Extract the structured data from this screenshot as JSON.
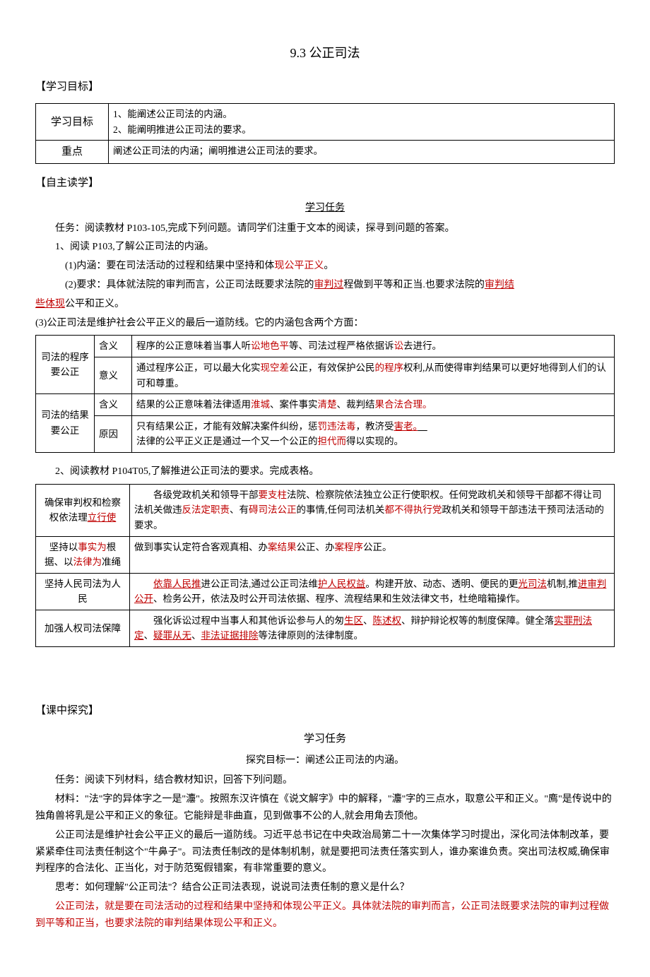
{
  "title": "9.3 公正司法",
  "sections": {
    "s1_heading": "【学习目标】",
    "s2_heading": "【自主读学】",
    "s3_heading": "【课中探究】"
  },
  "goal_table": {
    "r1c1": "学习目标",
    "r1c2_line1": "1、能阐述公正司法的内涵。",
    "r1c2_line2": "2、能阐明推进公正司法的要求。",
    "r2c1": "重点",
    "r2c2": "阐述公正司法的内涵；阐明推进公正司法的要求。"
  },
  "tasks": {
    "task_title": "学习任务",
    "task_intro": "任务：阅读教材 P103-105,完成下列问题。请同学们注重于文本的阅读，探寻到问题的答案。",
    "q1": "1、阅读 P103,了解公正司法的内涵。",
    "q1_1_pre": "(1)内涵：要在司法活动的过程和结果中坚持和体",
    "q1_1_red": "现公平正义",
    "q1_1_post": "。",
    "q1_2_pre": "(2)要求：具体就法院的审判而言，公正司法既要求法院的",
    "q1_2_red1": "审判过",
    "q1_2_mid": "程做到平等和正当.也要求法院的",
    "q1_2_red2": "审判结",
    "q1_2b_red": "些体现",
    "q1_2b_post": "公平和正义。",
    "q1_3": "(3)公正司法是维护社会公平正义的最后一道防线。它的内涵包含两个方面：",
    "q2": "2、阅读教材 P104T05,了解推进公正司法的要求。完成表格。"
  },
  "table1": {
    "r1c1": "司法的程序要公正",
    "r1c2a": "含义",
    "r1c3a_pre": "程序的公正意味着当事人听",
    "r1c3a_red1": "讼地色平",
    "r1c3a_mid": "等、司法过程严格依据诉",
    "r1c3a_red2": "讼",
    "r1c3a_post": "去进行。",
    "r1c2b": "意义",
    "r1c3b_pre": "通过程序公正，可以最大化实",
    "r1c3b_red1": "现空差",
    "r1c3b_mid": "公正，有效保护公民",
    "r1c3b_red2": "的程序",
    "r1c3b_post": "权利,从而使得审判结果可以更好地得到人们的认可和尊重。",
    "r2c1": "司法的结果要公正",
    "r2c2a": "含义",
    "r2c3a_pre": "结果的公正意味着法律适用",
    "r2c3a_red1": "淮城",
    "r2c3a_mid1": "、案件事实",
    "r2c3a_red2": "清楚",
    "r2c3a_mid2": "、裁判结",
    "r2c3a_red3": "果合法合理。",
    "r2c2b": "原因",
    "r2c3b_line1_pre": "只有结果公正，才能有效解决案件纠纷，惩",
    "r2c3b_line1_red1": "罚违法毒",
    "r2c3b_line1_mid": "，教济受",
    "r2c3b_line1_red2": "害老。",
    "r2c3b_line2_pre": "法律的公平正义正是通过一个又一个公正的",
    "r2c3b_line2_red": "担代而",
    "r2c3b_line2_post": "得以实现的。"
  },
  "table2": {
    "r1c1_pre": "确保审判权和检察权依法理",
    "r1c1_red": "立行使",
    "r1c2_pre": "　　各级党政机关和领导干部",
    "r1c2_red1": "要支柱",
    "r1c2_mid1": "法院、检察院依法独立公正行使职权。任何党政机关和领导干部都不得让司法机关做违",
    "r1c2_red2": "反法定职责",
    "r1c2_mid2": "、有",
    "r1c2_red3": "碍司法公正",
    "r1c2_mid3": "的事情,任何司法机关",
    "r1c2_red4": "都不得执行党",
    "r1c2_post": "政机关和领导干部违法干预司法活动的要求。",
    "r2c1_pre": "坚持以",
    "r2c1_red1": "事实为",
    "r2c1_mid": "根据、以",
    "r2c1_red2": "法律为",
    "r2c1_post": "准绳",
    "r2c2_pre": "做到事实认定符合客观真相、办",
    "r2c2_red1": "案结果",
    "r2c2_mid": "公正、办",
    "r2c2_red2": "案程序",
    "r2c2_post": "公正。",
    "r3c1": "坚持人民司法为人民",
    "r3c2_pre": "　　",
    "r3c2_red1": "依靠人民推",
    "r3c2_mid1": "进公正司法,通过公正司法维",
    "r3c2_red2": "护人民权益",
    "r3c2_mid2": "。构建开放、动态、透明、便民的更",
    "r3c2_red3": "光司法",
    "r3c2_mid3": "机制,推",
    "r3c2_red4": "进审判公开",
    "r3c2_post": "、检务公开，依法及时公开司法依据、程序、流程结果和生效法律文书，杜绝暗箱操作。",
    "r4c1": "加强人权司法保障",
    "r4c2_pre": "　　强化诉讼过程中当事人和其他诉讼参与人的匆",
    "r4c2_red1": "生区",
    "r4c2_mid1": "、",
    "r4c2_red2": "陈述权",
    "r4c2_mid2": "、辩护辩论权等的制度保障。健全落",
    "r4c2_red3": "实罪刑法定",
    "r4c2_mid3": "、",
    "r4c2_red4": "疑罪从无",
    "r4c2_mid4": "、",
    "r4c2_red5": "非法证据排除",
    "r4c2_post": "等法律原则的法律制度。"
  },
  "s3": {
    "task_title": "学习任务",
    "subtitle": "探究目标一：阐述公正司法的内涵。",
    "p1": "任务：阅读下列材料，结合教材知识，回答下列问题。",
    "p2": "材料：\"法\"字的异体字之一是\"灋\"。按照东汉许慎在《说文解字》中的解释，\"灋\"字的三点水，取意公平和正义。\"廌\"是传说中的独角兽将乳是公平和正义的象征。它能辩是非曲直，见到做事不公的人,就会用角去顶他。",
    "p3": "公正司法是维护社会公平正义的最后一道防线。习近平总书记在中央政治局第二十一次集体学习时提出，深化司法体制改革，要紧紧牵住司法责任制这个\"牛鼻子\"。司法责任制改的是体制机制，就是要把司法责任落实到人，谁办案谁负责。突出司法权威,确保审判程序的合法化、正当化，对于防范冤假错案，有非常重要的意义。",
    "p4": "思考：如何理解\"公正司法\"？结合公正司法表现，说说司法责任制的意义是什么？",
    "p5": "公正司法，就是要在司法活动的过程和结果中坚持和体现公平正义。具体就法院的审判而言，公正司法既要求法院的审判过程做到平等和正当，也要求法院的审判结果体现公平和正义。"
  }
}
